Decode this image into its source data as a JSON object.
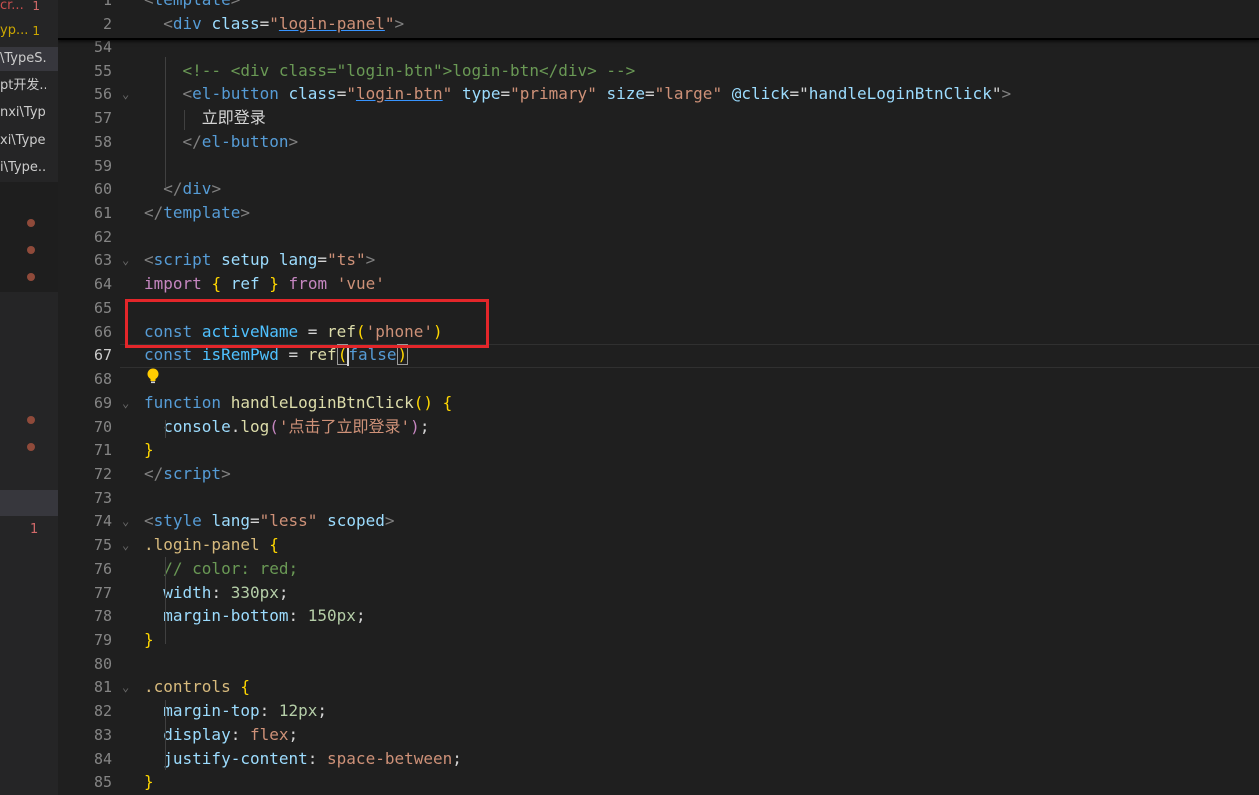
{
  "sidebar": {
    "items": [
      {
        "label": "cr...",
        "badge": "1",
        "color": "#c94e4e",
        "badgeColor": "#d16969"
      },
      {
        "label": "yp...",
        "badge": "1",
        "color": "#cca700",
        "badgeColor": "#cca700"
      },
      {
        "label": "\\TypeS...",
        "badge": "",
        "color": "#cccccc",
        "selected": true
      },
      {
        "label": "pt开发...",
        "badge": "",
        "color": "#cccccc"
      },
      {
        "label": "nxi\\Typ...",
        "badge": "",
        "color": "#cccccc"
      },
      {
        "label": "xi\\Type...",
        "badge": "",
        "color": "#cccccc"
      },
      {
        "label": "i\\Type...",
        "badge": "",
        "color": "#cccccc"
      }
    ],
    "lower_badge": "1",
    "dot_color": "#8f4a3a"
  },
  "editor": {
    "sticky": [
      {
        "num": "1",
        "code": [
          [
            "t-tag",
            "<"
          ],
          [
            "t-tn",
            "template"
          ],
          [
            "t-tag",
            ">"
          ]
        ]
      },
      {
        "num": "2",
        "code": [
          [
            "t-p",
            "  "
          ],
          [
            "t-tag",
            "<"
          ],
          [
            "t-tn",
            "div"
          ],
          [
            "t-p",
            " "
          ],
          [
            "t-an",
            "class"
          ],
          [
            "t-p",
            "="
          ],
          [
            "t-str",
            "\""
          ],
          [
            "t-str t-ul",
            "login-panel"
          ],
          [
            "t-str",
            "\""
          ],
          [
            "t-tag",
            ">"
          ]
        ]
      }
    ],
    "lines": [
      {
        "num": "54",
        "code": []
      },
      {
        "num": "55",
        "code": [
          [
            "t-p",
            "    "
          ],
          [
            "t-cm",
            "<!-- <div class=\"login-btn\">login-btn</div> -->"
          ]
        ]
      },
      {
        "num": "56",
        "fold": true,
        "code": [
          [
            "t-p",
            "    "
          ],
          [
            "t-tag",
            "<"
          ],
          [
            "t-tn",
            "el-button"
          ],
          [
            "t-p",
            " "
          ],
          [
            "t-an",
            "class"
          ],
          [
            "t-p",
            "="
          ],
          [
            "t-str",
            "\""
          ],
          [
            "t-str t-ul",
            "login-btn"
          ],
          [
            "t-str",
            "\""
          ],
          [
            "t-p",
            " "
          ],
          [
            "t-an",
            "type"
          ],
          [
            "t-p",
            "="
          ],
          [
            "t-str",
            "\"primary\""
          ],
          [
            "t-p",
            " "
          ],
          [
            "t-an",
            "size"
          ],
          [
            "t-p",
            "="
          ],
          [
            "t-str",
            "\"large\""
          ],
          [
            "t-p",
            " "
          ],
          [
            "t-an",
            "@click"
          ],
          [
            "t-p",
            "="
          ],
          [
            "t-p",
            "\""
          ],
          [
            "t-an",
            "handleLoginBtnClick"
          ],
          [
            "t-p",
            "\""
          ],
          [
            "t-tag",
            ">"
          ]
        ]
      },
      {
        "num": "57",
        "code": [
          [
            "t-p",
            "      立即登录"
          ]
        ]
      },
      {
        "num": "58",
        "code": [
          [
            "t-p",
            "    "
          ],
          [
            "t-tag",
            "</"
          ],
          [
            "t-tn",
            "el-button"
          ],
          [
            "t-tag",
            ">"
          ]
        ]
      },
      {
        "num": "59",
        "code": []
      },
      {
        "num": "60",
        "code": [
          [
            "t-p",
            "  "
          ],
          [
            "t-tag",
            "</"
          ],
          [
            "t-tn",
            "div"
          ],
          [
            "t-tag",
            ">"
          ]
        ]
      },
      {
        "num": "61",
        "code": [
          [
            "t-tag",
            "</"
          ],
          [
            "t-tn",
            "template"
          ],
          [
            "t-tag",
            ">"
          ]
        ]
      },
      {
        "num": "62",
        "code": []
      },
      {
        "num": "63",
        "fold": true,
        "code": [
          [
            "t-tag",
            "<"
          ],
          [
            "t-tn",
            "script"
          ],
          [
            "t-p",
            " "
          ],
          [
            "t-an",
            "setup"
          ],
          [
            "t-p",
            " "
          ],
          [
            "t-an",
            "lang"
          ],
          [
            "t-p",
            "="
          ],
          [
            "t-str",
            "\"ts\""
          ],
          [
            "t-tag",
            ">"
          ]
        ]
      },
      {
        "num": "64",
        "code": [
          [
            "t-kc",
            "import"
          ],
          [
            "t-p",
            " "
          ],
          [
            "t-br",
            "{"
          ],
          [
            "t-p",
            " "
          ],
          [
            "t-var",
            "ref"
          ],
          [
            "t-p",
            " "
          ],
          [
            "t-br",
            "}"
          ],
          [
            "t-p",
            " "
          ],
          [
            "t-kc",
            "from"
          ],
          [
            "t-p",
            " "
          ],
          [
            "t-str",
            "'vue'"
          ]
        ]
      },
      {
        "num": "65",
        "code": []
      },
      {
        "num": "66",
        "code": [
          [
            "t-kw",
            "const"
          ],
          [
            "t-p",
            " "
          ],
          [
            "t-cn",
            "activeName"
          ],
          [
            "t-p",
            " = "
          ],
          [
            "t-fn",
            "ref"
          ],
          [
            "t-br",
            "("
          ],
          [
            "t-str",
            "'phone'"
          ],
          [
            "t-br",
            ")"
          ]
        ]
      },
      {
        "num": "67",
        "active": true,
        "code": [
          [
            "t-kw",
            "const"
          ],
          [
            "t-p",
            " "
          ],
          [
            "t-cn",
            "isRemPwd"
          ],
          [
            "t-p",
            " = "
          ],
          [
            "t-fn",
            "ref"
          ],
          [
            "t-br bracket-box",
            "("
          ],
          [
            "t-kw",
            "false"
          ],
          [
            "t-br bracket-box",
            ")"
          ]
        ]
      },
      {
        "num": "68",
        "code": []
      },
      {
        "num": "69",
        "fold": true,
        "code": [
          [
            "t-kw",
            "function"
          ],
          [
            "t-p",
            " "
          ],
          [
            "t-fn",
            "handleLoginBtnClick"
          ],
          [
            "t-br",
            "()"
          ],
          [
            "t-p",
            " "
          ],
          [
            "t-br",
            "{"
          ]
        ]
      },
      {
        "num": "70",
        "code": [
          [
            "t-p",
            "  "
          ],
          [
            "t-var",
            "console"
          ],
          [
            "t-p",
            "."
          ],
          [
            "t-fn",
            "log"
          ],
          [
            "t-kc",
            "("
          ],
          [
            "t-str",
            "'点击了立即登录'"
          ],
          [
            "t-kc",
            ")"
          ],
          [
            "t-p",
            ";"
          ]
        ]
      },
      {
        "num": "71",
        "code": [
          [
            "t-br",
            "}"
          ]
        ]
      },
      {
        "num": "72",
        "code": [
          [
            "t-tag",
            "</"
          ],
          [
            "t-tn",
            "script"
          ],
          [
            "t-tag",
            ">"
          ]
        ]
      },
      {
        "num": "73",
        "code": []
      },
      {
        "num": "74",
        "fold": true,
        "code": [
          [
            "t-tag",
            "<"
          ],
          [
            "t-tn",
            "style"
          ],
          [
            "t-p",
            " "
          ],
          [
            "t-an",
            "lang"
          ],
          [
            "t-p",
            "="
          ],
          [
            "t-str",
            "\"less\""
          ],
          [
            "t-p",
            " "
          ],
          [
            "t-an",
            "scoped"
          ],
          [
            "t-tag",
            ">"
          ]
        ]
      },
      {
        "num": "75",
        "fold": true,
        "code": [
          [
            "t-cls",
            ".login-panel"
          ],
          [
            "t-p",
            " "
          ],
          [
            "t-br",
            "{"
          ]
        ]
      },
      {
        "num": "76",
        "code": [
          [
            "t-p",
            "  "
          ],
          [
            "t-cm",
            "// color: red;"
          ]
        ]
      },
      {
        "num": "77",
        "code": [
          [
            "t-p",
            "  "
          ],
          [
            "t-prop",
            "width"
          ],
          [
            "t-p",
            ": "
          ],
          [
            "t-num",
            "330px"
          ],
          [
            "t-p",
            ";"
          ]
        ]
      },
      {
        "num": "78",
        "code": [
          [
            "t-p",
            "  "
          ],
          [
            "t-prop",
            "margin-bottom"
          ],
          [
            "t-p",
            ": "
          ],
          [
            "t-num",
            "150px"
          ],
          [
            "t-p",
            ";"
          ]
        ]
      },
      {
        "num": "79",
        "code": [
          [
            "t-br",
            "}"
          ]
        ]
      },
      {
        "num": "80",
        "code": []
      },
      {
        "num": "81",
        "fold": true,
        "code": [
          [
            "t-cls",
            ".controls"
          ],
          [
            "t-p",
            " "
          ],
          [
            "t-br",
            "{"
          ]
        ]
      },
      {
        "num": "82",
        "code": [
          [
            "t-p",
            "  "
          ],
          [
            "t-prop",
            "margin-top"
          ],
          [
            "t-p",
            ": "
          ],
          [
            "t-num",
            "12px"
          ],
          [
            "t-p",
            ";"
          ]
        ]
      },
      {
        "num": "83",
        "code": [
          [
            "t-p",
            "  "
          ],
          [
            "t-prop",
            "display"
          ],
          [
            "t-p",
            ": "
          ],
          [
            "t-val",
            "flex"
          ],
          [
            "t-p",
            ";"
          ]
        ]
      },
      {
        "num": "84",
        "code": [
          [
            "t-p",
            "  "
          ],
          [
            "t-prop",
            "justify-content"
          ],
          [
            "t-p",
            ": "
          ],
          [
            "t-val",
            "space-between"
          ],
          [
            "t-p",
            ";"
          ]
        ]
      },
      {
        "num": "85",
        "code": [
          [
            "t-br",
            "}"
          ]
        ]
      }
    ]
  },
  "icons": {
    "lightbulb": "lightbulb-icon",
    "fold": "chevron-down-icon"
  }
}
